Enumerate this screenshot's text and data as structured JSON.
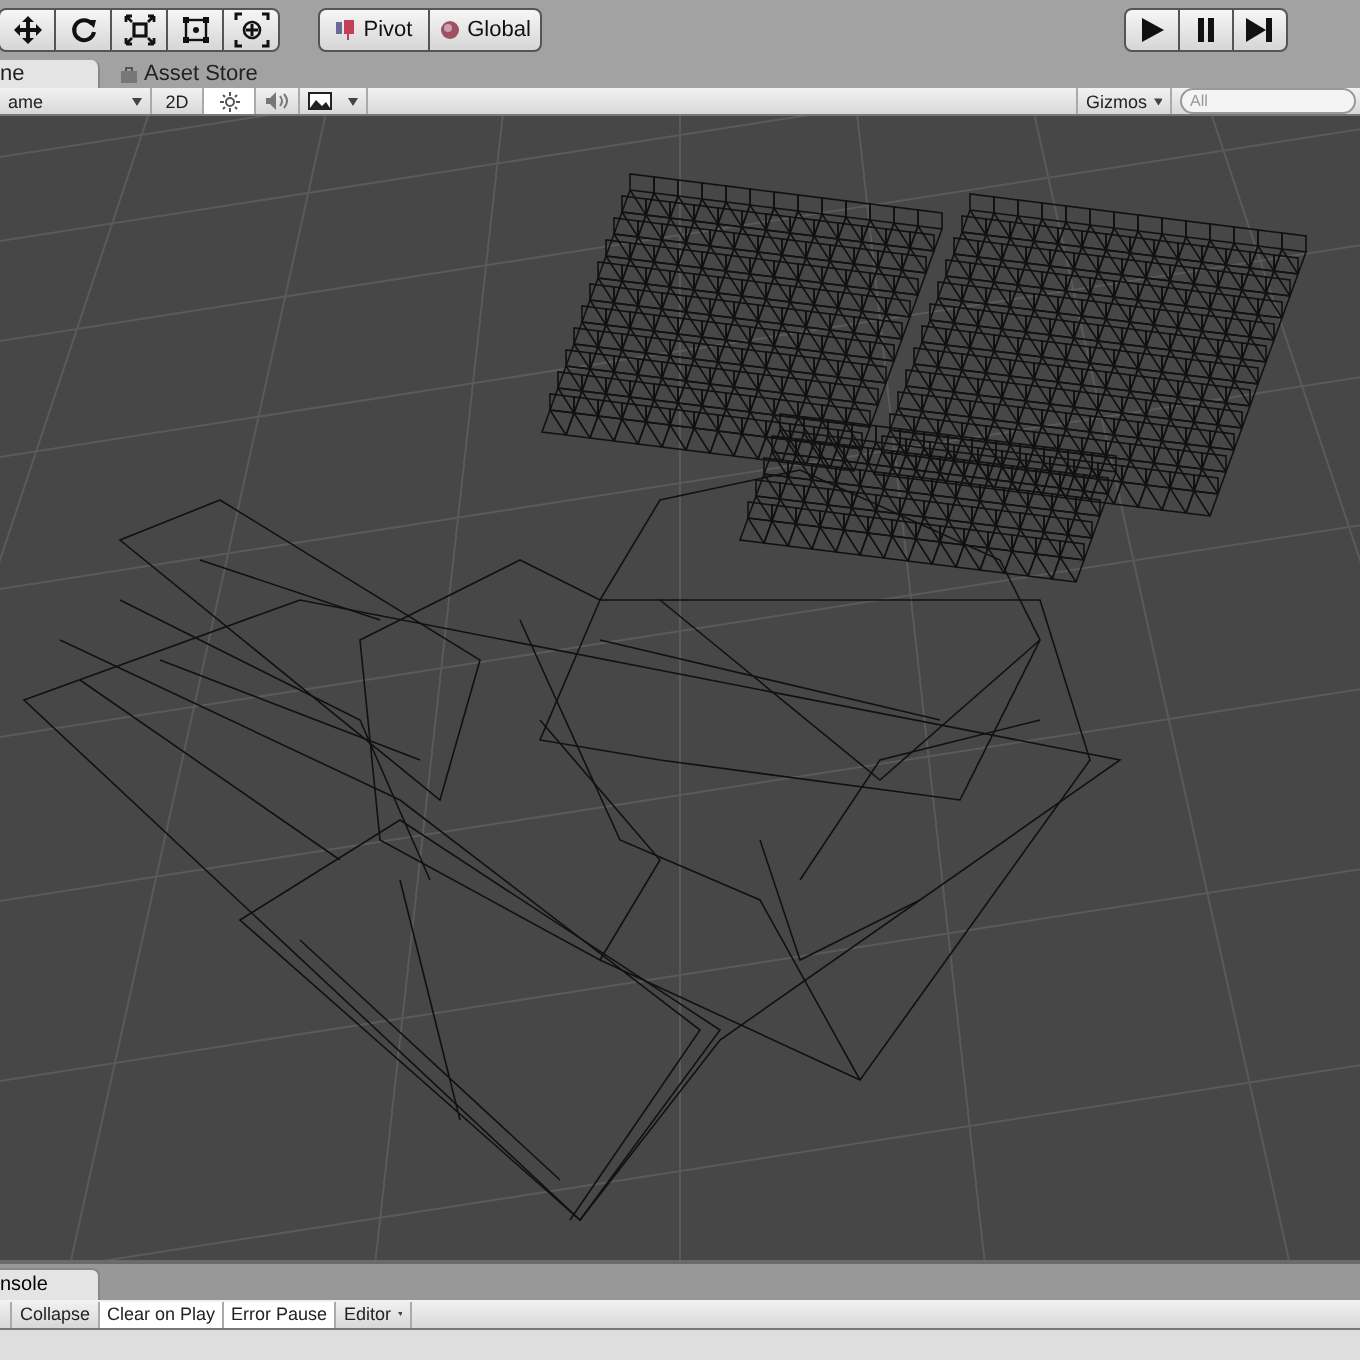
{
  "toolbar": {
    "tools": [
      {
        "kind": "move",
        "selected": false
      },
      {
        "kind": "rotate",
        "selected": false
      },
      {
        "kind": "scale",
        "selected": false
      },
      {
        "kind": "rect",
        "selected": false
      },
      {
        "kind": "transform",
        "selected": false
      }
    ],
    "pivot": [
      {
        "kind": "pivot",
        "label": "Pivot"
      },
      {
        "kind": "global",
        "label": "Global"
      }
    ],
    "playback": [
      {
        "kind": "play"
      },
      {
        "kind": "pause"
      },
      {
        "kind": "step"
      }
    ]
  },
  "tabs": [
    {
      "label": "ne",
      "selected": true
    },
    {
      "label": "Asset Store",
      "selected": false
    }
  ],
  "scene_toolbar": {
    "draw_mode": "ame",
    "mode_2d": {
      "label": "2D",
      "on": false
    },
    "lighting": {
      "on": true
    },
    "audio": {
      "on": false
    },
    "effects": {
      "on": false
    },
    "gizmos": "Gizmos",
    "search": {
      "placeholder": "All"
    }
  },
  "console": {
    "tab": "nsole",
    "buttons": [
      {
        "label": "Collapse",
        "on": false
      },
      {
        "label": "Clear on Play",
        "on": true
      },
      {
        "label": "Error Pause",
        "on": true
      }
    ],
    "editor": "Editor"
  }
}
